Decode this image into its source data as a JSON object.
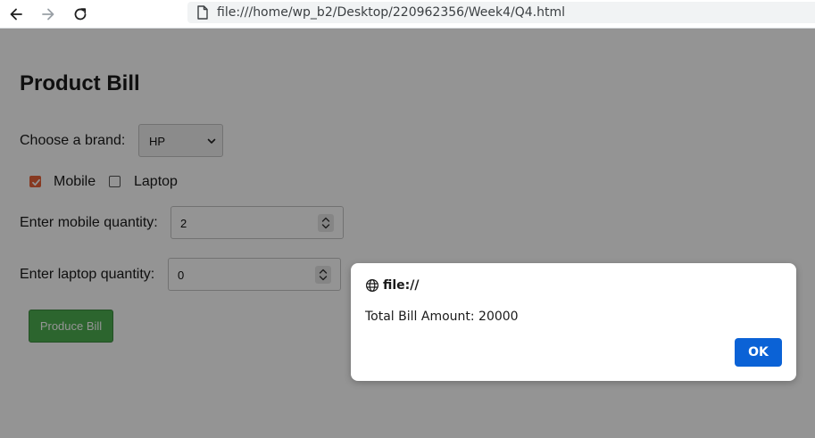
{
  "browser": {
    "url": "file:///home/wp_b2/Desktop/220962356/Week4/Q4.html",
    "icons": {
      "back": "arrow-left-icon",
      "forward": "arrow-right-icon",
      "reload": "reload-icon",
      "page": "page-icon"
    }
  },
  "page": {
    "heading": "Product Bill",
    "brand": {
      "label": "Choose a brand:",
      "selected": "HP"
    },
    "products": [
      {
        "label": "Mobile",
        "checked": true
      },
      {
        "label": "Laptop",
        "checked": false
      }
    ],
    "mobile_quantity": {
      "label": "Enter mobile quantity:",
      "value": "2"
    },
    "laptop_quantity": {
      "label": "Enter laptop quantity:",
      "value": "0"
    },
    "produce_button": "Produce Bill",
    "colors": {
      "checkbox_accent": "#e8623a",
      "button_green": "#4caf50"
    }
  },
  "dialog": {
    "origin": "file://",
    "message": "Total Bill Amount: 20000",
    "ok_label": "OK",
    "icon": "globe-icon",
    "colors": {
      "ok_button": "#0b62d6"
    }
  }
}
